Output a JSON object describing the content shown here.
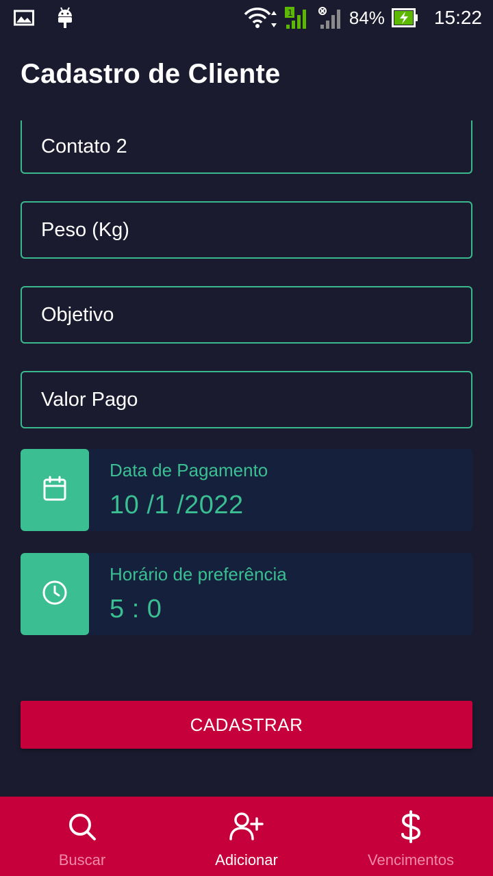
{
  "status_bar": {
    "battery_percent": "84%",
    "time": "15:22",
    "icons": [
      "image-icon",
      "android-icon",
      "wifi-icon",
      "signal-icon",
      "signal-off-icon",
      "battery-charging-icon"
    ]
  },
  "header": {
    "title": "Cadastro de Cliente"
  },
  "form": {
    "fields": [
      {
        "placeholder": "Contato 2"
      },
      {
        "placeholder": "Peso (Kg)"
      },
      {
        "placeholder": "Objetivo"
      },
      {
        "placeholder": "Valor Pago"
      }
    ],
    "date_picker": {
      "label": "Data de Pagamento",
      "value": "10 /1 /2022",
      "icon": "calendar-icon"
    },
    "time_picker": {
      "label": "Horário de preferência",
      "value": "5 : 0",
      "icon": "clock-icon"
    },
    "submit_label": "CADASTRAR"
  },
  "bottom_nav": {
    "items": [
      {
        "label": "Buscar",
        "icon": "search-icon",
        "active": false
      },
      {
        "label": "Adicionar",
        "icon": "add-user-icon",
        "active": true
      },
      {
        "label": "Vencimentos",
        "icon": "dollar-icon",
        "active": false
      }
    ]
  },
  "colors": {
    "background": "#1b1b2f",
    "accent_green": "#3bbf92",
    "primary_red": "#c6003a",
    "picker_bg": "#15203d"
  }
}
